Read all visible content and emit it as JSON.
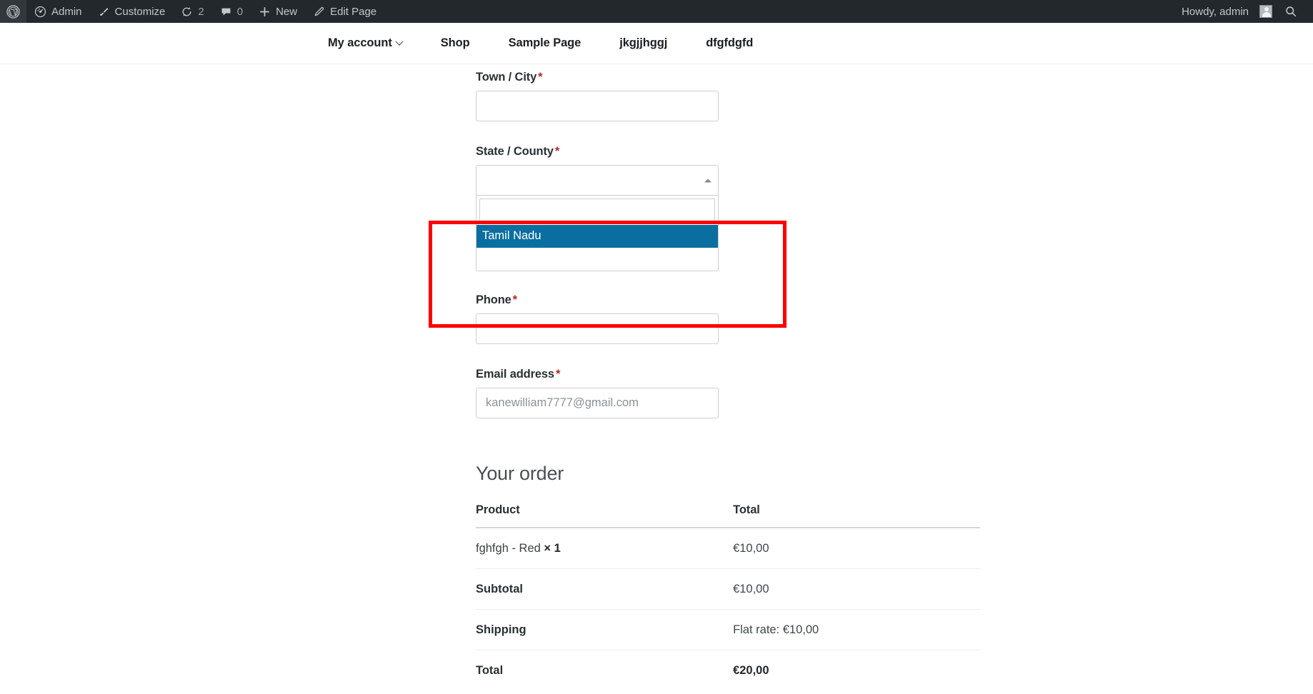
{
  "adminbar": {
    "logo_icon": "wordpress-logo-icon",
    "items": [
      {
        "icon": "dashboard-icon",
        "label": "Admin"
      },
      {
        "icon": "customize-brush-icon",
        "label": "Customize"
      },
      {
        "icon": "updates-refresh-icon",
        "label": "2"
      },
      {
        "icon": "comment-bubble-icon",
        "label": "0"
      },
      {
        "icon": "plus-icon",
        "label": "New"
      },
      {
        "icon": "edit-pencil-icon",
        "label": "Edit Page"
      }
    ],
    "howdy": "Howdy, admin",
    "avatar_icon": "user-avatar-icon",
    "search_icon": "search-icon"
  },
  "nav": {
    "items": [
      {
        "label": "My account",
        "has_submenu": true
      },
      {
        "label": "Shop",
        "has_submenu": false
      },
      {
        "label": "Sample Page",
        "has_submenu": false
      },
      {
        "label": "jkgjjhggj",
        "has_submenu": false
      },
      {
        "label": "dfgfdgfd",
        "has_submenu": false
      }
    ]
  },
  "checkout": {
    "city": {
      "label": "Town / City",
      "required_mark": "*",
      "value": "",
      "placeholder": ""
    },
    "state": {
      "label": "State / County",
      "required_mark": "*",
      "selected_text": "",
      "search_value": "",
      "search_placeholder": "",
      "options": [
        {
          "text": "Tamil Nadu",
          "highlighted": true
        },
        {
          "text": "",
          "highlighted": false
        }
      ],
      "arrow_icon": "caret-up-icon"
    },
    "phone": {
      "label": "Phone",
      "required_mark": "*",
      "value": "",
      "placeholder": ""
    },
    "email": {
      "label": "Email address",
      "required_mark": "*",
      "value": "",
      "placeholder": "kanewilliam7777@gmail.com"
    }
  },
  "order": {
    "title": "Your order",
    "columns": {
      "product": "Product",
      "total": "Total"
    },
    "rows": [
      {
        "type": "product",
        "label": "fghfgh - Red",
        "qty": "× 1",
        "value": "€10,00"
      },
      {
        "type": "summary",
        "label": "Subtotal",
        "qty": "",
        "value": "€10,00"
      },
      {
        "type": "summary",
        "label": "Shipping",
        "qty": "",
        "value": "Flat rate: €10,00"
      },
      {
        "type": "total",
        "label": "Total",
        "qty": "",
        "value": "€20,00"
      }
    ]
  },
  "annotation": {
    "highlight_color": "#fe0000",
    "highlight_target": "state-county-select-dropdown"
  },
  "colors": {
    "adminbar_bg": "#23282d",
    "option_highlight_bg": "#0a6ea0",
    "required_star": "#b02a2a",
    "annotation_red": "#fe0000"
  }
}
